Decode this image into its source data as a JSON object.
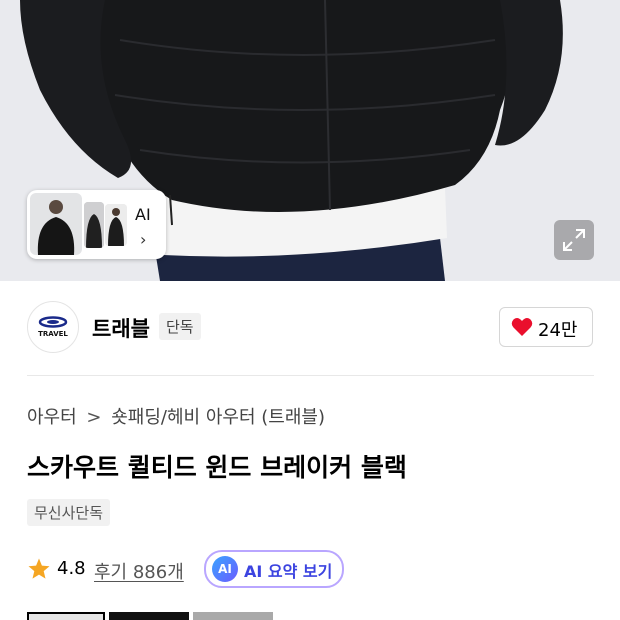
{
  "hero": {
    "thumbnail_panel": {
      "ai_label": "AI",
      "chevron": "›"
    }
  },
  "brand": {
    "name": "트래블",
    "exclusive_badge": "단독",
    "logo_text": "TRAVEL"
  },
  "like": {
    "count": "24만",
    "icon": "heart-icon",
    "color": "#ea0f2d"
  },
  "breadcrumb": {
    "items": [
      "아우터",
      "숏패딩/헤비 아우터 (트래블)"
    ],
    "separator": ">"
  },
  "product": {
    "title": "스카우트 퀼티드 윈드 브레이커 블랙",
    "tag": "무신사단독"
  },
  "rating": {
    "score": "4.8",
    "reviews": "후기 886개",
    "star_color": "#f5a623"
  },
  "ai_summary": {
    "badge": "AI",
    "label": "AI 요약 보기",
    "accent": "#3c44e0"
  }
}
